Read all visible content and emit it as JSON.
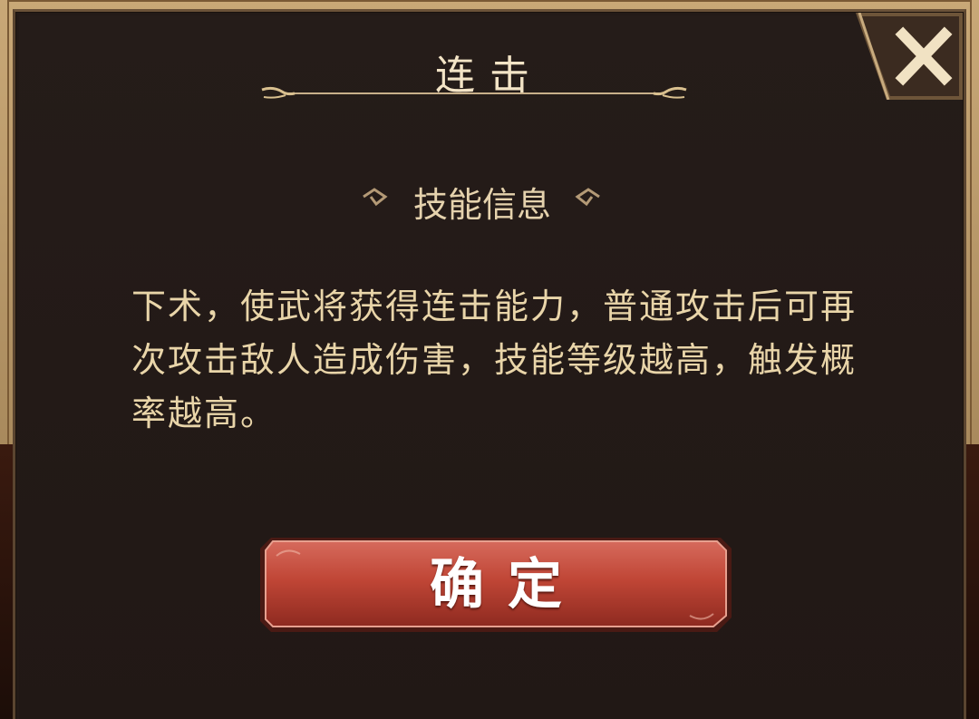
{
  "dialog": {
    "title": "连击",
    "close_label": "X",
    "section_header": "技能信息",
    "description": "下术，使武将获得连击能力，普通攻击后可再次攻击敌人造成伤害，技能等级越高，触发概率越高。",
    "confirm_label": "确定"
  },
  "colors": {
    "panel": "#231a17",
    "title_text": "#f3e4c6",
    "body_text": "#e9d5a9",
    "gold": "#c8a878",
    "button_red": "#b23a2e"
  },
  "icons": {
    "close": "close-x-icon",
    "title_ornament": "scroll-ornament-icon",
    "section_ornament": "cloud-swirl-ornament-icon"
  }
}
